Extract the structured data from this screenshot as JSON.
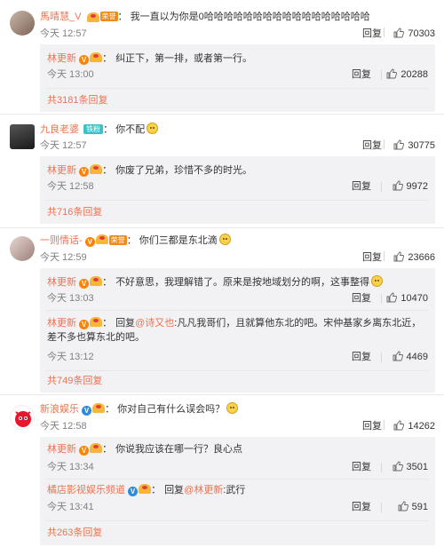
{
  "labels": {
    "reply": "回复",
    "fan_badge": "铁粉",
    "honor_badge": "荣誉"
  },
  "comments": [
    {
      "user": "馬晴慧_V",
      "text": "我一直以为你是0哈哈哈哈哈哈哈哈哈哈哈哈哈哈哈哈哈",
      "time": "今天 12:57",
      "likes": "70303",
      "replies": [
        {
          "user": "林更新",
          "text": "纠正下，第一排，或者第一行。",
          "time": "今天 13:00",
          "likes": "20288"
        }
      ],
      "total": "共3181条回复"
    },
    {
      "user": "九良老婆",
      "text": "你不配",
      "time": "今天 12:57",
      "likes": "30775",
      "replies": [
        {
          "user": "林更新",
          "text": "你废了兄弟，珍惜不多的时光。",
          "time": "今天 12:58",
          "likes": "9972"
        }
      ],
      "total": "共716条回复"
    },
    {
      "user": "一则情话-",
      "text": "你们三都是东北滴",
      "time": "今天 12:59",
      "likes": "23666",
      "replies": [
        {
          "user": "林更新",
          "text": "不好意思，我理解错了。原来是按地域划分的啊，这事整得",
          "time": "今天 13:03",
          "likes": "10470"
        },
        {
          "user": "林更新",
          "text_prefix": "回复",
          "mention": "@诗又也",
          "text": ":凡凡我哥们，且就算他东北的吧。宋仲基家乡离东北近，差不多也算东北的吧。",
          "time": "今天 13:12",
          "likes": "4469"
        }
      ],
      "total": "共749条回复"
    },
    {
      "user": "新浪娱乐",
      "text": "你对自己有什么误会吗？",
      "time": "今天 12:58",
      "likes": "14262",
      "replies": [
        {
          "user": "林更新",
          "text": "你说我应该在哪一行？良心点",
          "time": "今天 13:34",
          "likes": "3501"
        },
        {
          "user": "橘店影视娱乐频道",
          "text_prefix": "回复",
          "mention": "@林更新",
          "text": ":武行",
          "time": "今天 13:41",
          "likes": "591"
        }
      ],
      "total": "共263条回复"
    }
  ],
  "colors": {
    "username": "#eb7350",
    "time": "#808080",
    "sub_bg": "#f2f2f5",
    "vip": "#ff8200",
    "blue_v": "#2d8bde"
  },
  "icons": [
    "thumb-up-icon",
    "v-badge-icon",
    "crown-badge-icon",
    "emoji-icon"
  ]
}
